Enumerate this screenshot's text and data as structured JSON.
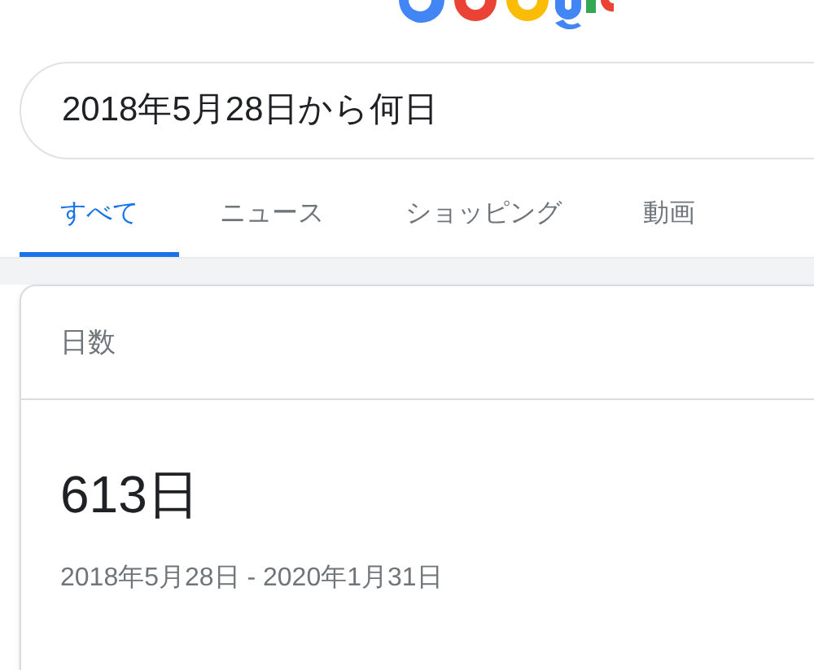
{
  "search": {
    "value": "2018年5月28日から何日"
  },
  "tabs": [
    {
      "label": "すべて",
      "selected": true
    },
    {
      "label": "ニュース",
      "selected": false
    },
    {
      "label": "ショッピング",
      "selected": false
    },
    {
      "label": "動画",
      "selected": false
    }
  ],
  "card": {
    "title": "日数",
    "result": "613日",
    "range": "2018年5月28日 - 2020年1月31日"
  }
}
